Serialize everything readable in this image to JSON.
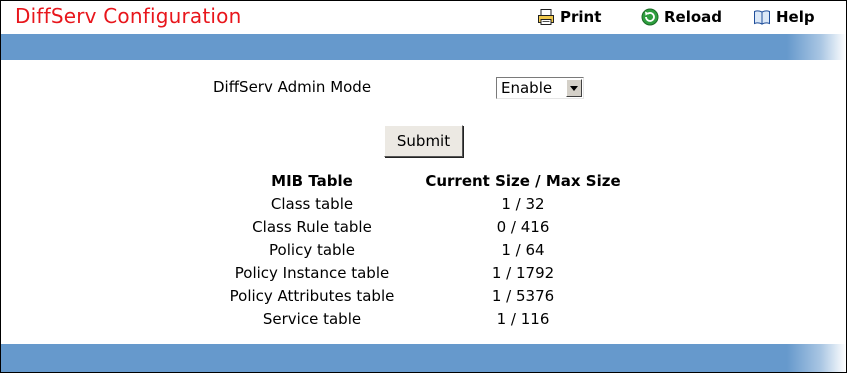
{
  "header": {
    "title": "DiffServ Configuration",
    "print_label": "Print",
    "reload_label": "Reload",
    "help_label": "Help"
  },
  "form": {
    "admin_mode_label": "DiffServ Admin Mode",
    "admin_mode_value": "Enable",
    "submit_label": "Submit"
  },
  "mib_table": {
    "columns": [
      "MIB Table",
      "Current Size / Max Size"
    ],
    "rows": [
      [
        "Class table",
        "1 / 32"
      ],
      [
        "Class Rule table",
        "0 / 416"
      ],
      [
        "Policy table",
        "1 / 64"
      ],
      [
        "Policy Instance table",
        "1 / 1792"
      ],
      [
        "Policy Attributes table",
        "1 / 5376"
      ],
      [
        "Service table",
        "1 / 116"
      ]
    ]
  },
  "colors": {
    "title": "#e8161c",
    "bar": "#6699cc",
    "reload_icon": "#2e9e3e"
  },
  "icons": {
    "print": "printer-icon",
    "reload": "reload-icon",
    "help": "help-book-icon"
  }
}
